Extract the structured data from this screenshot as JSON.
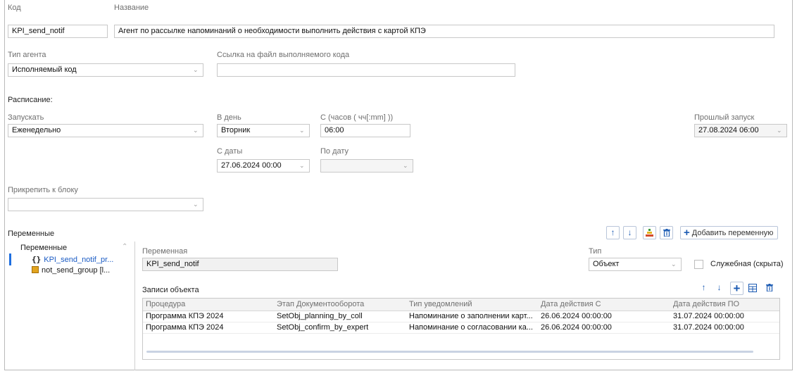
{
  "form": {
    "code_label": "Код",
    "code_value": "KPI_send_notif",
    "name_label": "Название",
    "name_value": "Агент по рассылке напоминаний о необходимости выполнить действия с картой КПЭ",
    "agent_type_label": "Тип агента",
    "agent_type_value": "Исполняемый код",
    "code_link_label": "Ссылка на файл выполняемого кода",
    "code_link_value": "",
    "schedule_label": "Расписание:",
    "run_label": "Запускать",
    "run_value": "Еженедельно",
    "day_label": "В день",
    "day_value": "Вторник",
    "time_label": "С (часов ( чч[:mm] ))",
    "time_value": "06:00",
    "last_run_label": "Прошлый запуск",
    "last_run_value": "27.08.2024  06:00",
    "from_date_label": "С даты",
    "from_date_value": "27.06.2024  00:00",
    "to_date_label": "По дату",
    "to_date_value": "",
    "attach_block_label": "Прикрепить к блоку",
    "attach_block_value": ""
  },
  "variables": {
    "section_label": "Переменные",
    "add_button_label": "Добавить переменную",
    "tree_root_label": "Переменные",
    "tree_items": [
      {
        "label": "KPI_send_notif_pr...",
        "icon": "braces-icon"
      },
      {
        "label": "not_send_group [l...",
        "icon": "list-icon"
      }
    ]
  },
  "variable_detail": {
    "var_label": "Переменная",
    "var_value": "KPI_send_notif",
    "type_label": "Тип",
    "type_value": "Объект",
    "service_label": "Служебная (скрыта)",
    "service_checked": false,
    "records_label": "Записи объекта",
    "columns": [
      "Процедура",
      "Этап Документооборота",
      "Тип уведомлений",
      "Дата действия С",
      "Дата действия ПО"
    ],
    "rows": [
      [
        "Программа КПЭ 2024",
        "SetObj_planning_by_coll",
        "Напоминание о заполнении карт...",
        "26.06.2024 00:00:00",
        "31.07.2024 00:00:00"
      ],
      [
        "Программа КПЭ 2024",
        "SetObj_confirm_by_expert",
        "Напоминание о согласовании ка...",
        "26.06.2024 00:00:00",
        "31.07.2024 00:00:00"
      ]
    ]
  },
  "colors": {
    "accent": "#1c5bb3",
    "tree_selection": "#1f6fe0"
  }
}
